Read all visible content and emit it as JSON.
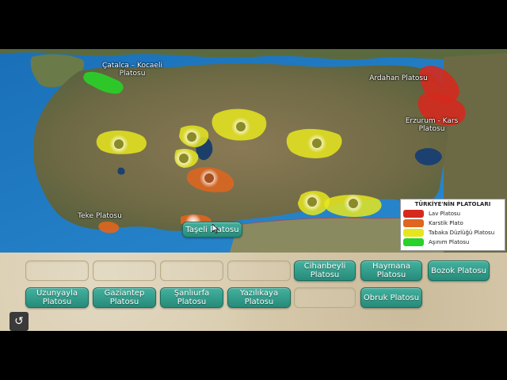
{
  "colors": {
    "lava": "#d42a1e",
    "karst": "#e0651e",
    "layered": "#e6e61e",
    "erosion": "#28d228",
    "tile": "#33a08e",
    "panel": "#d9ccae"
  },
  "map_labels": {
    "catalca": "Çatalca – Kocaeli\nPlatosu",
    "ardahan": "Ardahan Platosu",
    "erzurum": "Erzurum - Kars\nPlatosu",
    "teke": "Teke Platosu"
  },
  "legend": {
    "title": "TÜRKİYE'NİN PLATOLARI",
    "items": [
      {
        "label": "Lav Platosu",
        "color": "#d42a1e"
      },
      {
        "label": "Karstik Plato",
        "color": "#e0651e"
      },
      {
        "label": "Tabaka Düzlüğü Platosu",
        "color": "#e6e61e"
      },
      {
        "label": "Aşınım Platosu",
        "color": "#28d228"
      }
    ]
  },
  "dropped_tile": "Taşeli Platosu",
  "tiles": {
    "cihanbeyli": "Cihanbeyli\nPlatosu",
    "haymana": "Haymana\nPlatosu",
    "bozok": "Bozok Platosu",
    "uzunyayla": "Uzunyayla\nPlatosu",
    "gaziantep": "Gaziantep\nPlatosu",
    "sanliurfa": "Şanlıurfa\nPlatosu",
    "yazilikaya": "Yazılıkaya\nPlatosu",
    "obruk": "Obruk Platosu"
  },
  "icons": {
    "reset": "↺"
  }
}
